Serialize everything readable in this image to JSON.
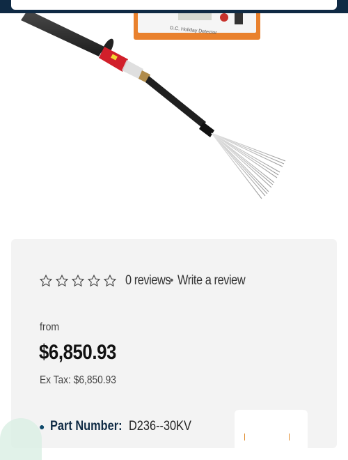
{
  "product": {
    "image_device_label": "D.C. Holiday Detector",
    "rating": {
      "stars_filled": 0,
      "stars_total": 5
    },
    "reviews_label": "0 reviews",
    "separator": "•",
    "write_review_label": "Write a review",
    "price_from_label": "from",
    "price": "$6,850.93",
    "ex_tax_label": "Ex Tax: $6,850.93",
    "part_number_label": "Part Number:",
    "part_number_value": "D236--30KV"
  },
  "colors": {
    "header_bg": "#0f2a44",
    "card_bg": "#f3f3f3",
    "device_orange": "#e9812d",
    "probe_red": "#d11f2a"
  },
  "icons": {
    "star": "star-outline-icon"
  }
}
